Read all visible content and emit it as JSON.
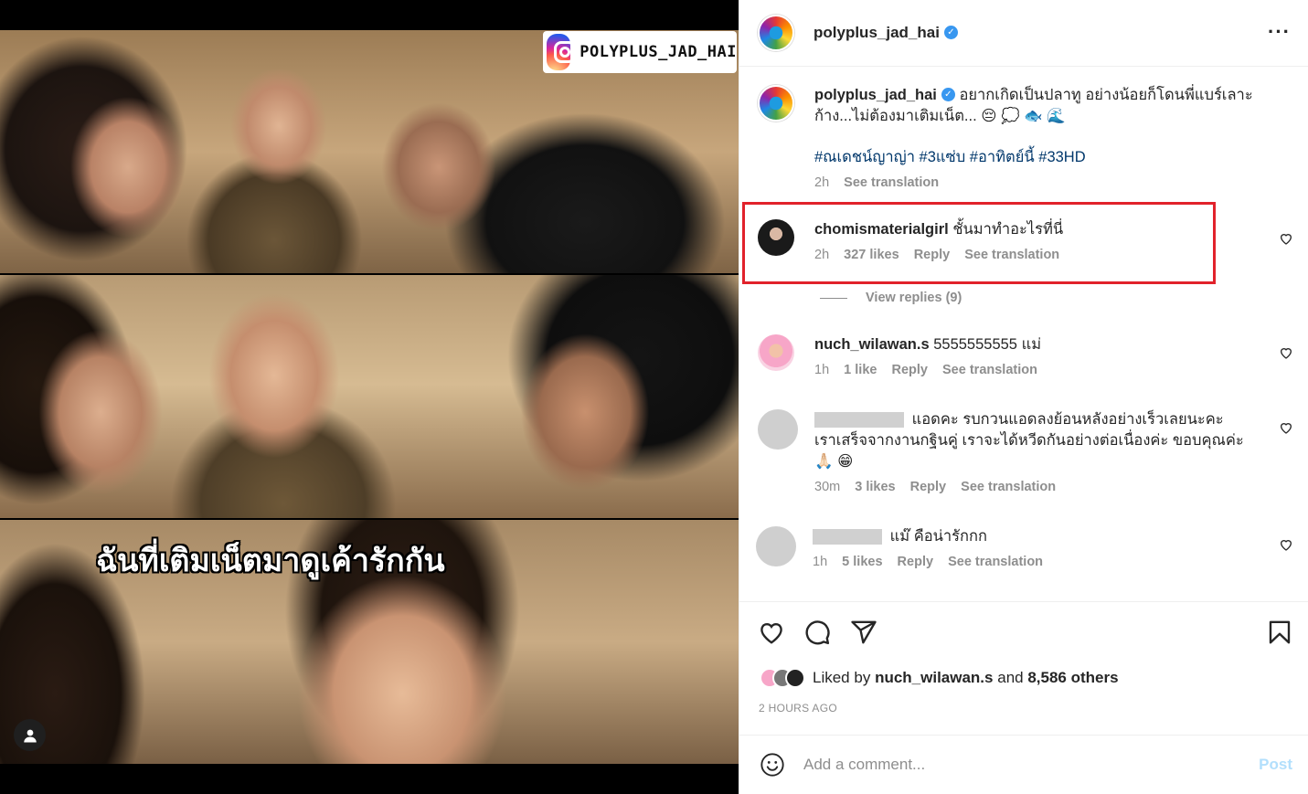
{
  "media": {
    "watermark_handle": "POLYPLUS_JAD_HAI",
    "caption_overlay": "ฉันที่เติมเน็ตมาดูเค้ารักกัน"
  },
  "header": {
    "username": "polyplus_jad_hai",
    "verified": true
  },
  "caption": {
    "username": "polyplus_jad_hai",
    "text": "อยากเกิดเป็นปลาทู อย่างน้อยก็โดนพี่แบร์เลาะก้าง...ไม่ต้องมาเติมเน็ต... 😔 💭 🐟 🌊",
    "hashtags": "#ณเดชน์ญาญ่า #3แซ่บ #อาทิตย์นี้ #33HD",
    "time": "2h",
    "see_translation": "See translation"
  },
  "comments": [
    {
      "username": "chomismaterialgirl",
      "text": "ชั้นมาทำอะไรที่นี่",
      "time": "2h",
      "likes": "327 likes",
      "reply": "Reply",
      "see_translation": "See translation",
      "highlighted": true
    },
    {
      "username": "nuch_wilawan.s",
      "text": "5555555555 แม่",
      "time": "1h",
      "likes": "1 like",
      "reply": "Reply",
      "see_translation": "See translation"
    },
    {
      "username": "",
      "text": "แอดคะ รบกวนแอดลงย้อนหลังอย่างเร็วเลยนะคะ เราเสร็จจากงานกฐินคู่ เราจะได้หวีดกันอย่างต่อเนื่องค่ะ ขอบคุณค่ะ 🙏🏻 😁",
      "time": "30m",
      "likes": "3 likes",
      "reply": "Reply",
      "see_translation": "See translation"
    },
    {
      "username": "",
      "text": "แม๊ คือน่ารักกก",
      "time": "1h",
      "likes": "5 likes",
      "reply": "Reply",
      "see_translation": "See translation"
    }
  ],
  "view_replies": "View replies (9)",
  "likes_summary": {
    "prefix": "Liked by",
    "user": "nuch_wilawan.s",
    "and": "and",
    "others": "8,586 others"
  },
  "time_ago": "2 HOURS AGO",
  "comment_input": {
    "placeholder": "Add a comment...",
    "post_label": "Post"
  },
  "icons": [
    "more-icon",
    "verified-icon",
    "heart-icon",
    "comment-icon",
    "share-icon",
    "bookmark-icon",
    "emoji-icon",
    "tag-user-icon",
    "instagram-logo"
  ],
  "colors": {
    "highlight_border": "#e1222b",
    "link": "#00376b",
    "secondary_text": "#8e8e8e",
    "post_disabled": "#b2dffc",
    "verified": "#3897f0"
  }
}
